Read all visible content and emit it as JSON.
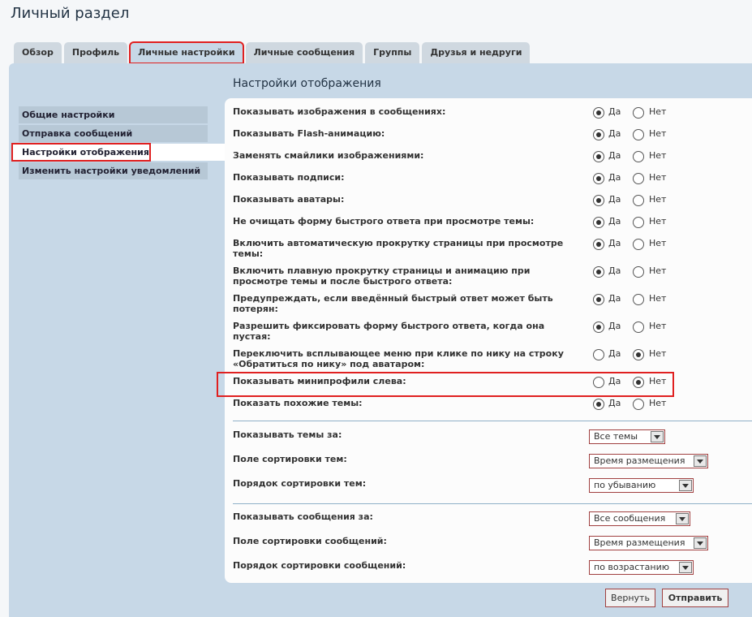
{
  "page": {
    "title": "Личный раздел"
  },
  "tabs": [
    {
      "label": "Обзор"
    },
    {
      "label": "Профиль"
    },
    {
      "label": "Личные настройки"
    },
    {
      "label": "Личные сообщения"
    },
    {
      "label": "Группы"
    },
    {
      "label": "Друзья и недруги"
    }
  ],
  "sidebar": {
    "items": [
      {
        "label": "Общие настройки"
      },
      {
        "label": "Отправка сообщений"
      },
      {
        "label": "Настройки отображения"
      },
      {
        "label": "Изменить настройки уведомлений"
      }
    ]
  },
  "section": {
    "title": "Настройки отображения"
  },
  "yes_label": "Да",
  "no_label": "Нет",
  "options": [
    {
      "label": "Показывать изображения в сообщениях:",
      "value": "Да"
    },
    {
      "label": "Показывать Flash-анимацию:",
      "value": "Да"
    },
    {
      "label": "Заменять смайлики изображениями:",
      "value": "Да"
    },
    {
      "label": "Показывать подписи:",
      "value": "Да"
    },
    {
      "label": "Показывать аватары:",
      "value": "Да"
    },
    {
      "label": "Не очищать форму быстрого ответа при просмотре темы:",
      "value": "Да"
    },
    {
      "label": "Включить автоматическую прокрутку страницы при просмотре темы:",
      "value": "Да"
    },
    {
      "label": "Включить плавную прокрутку страницы и анимацию при просмотре темы и после быстрого ответа:",
      "value": "Да"
    },
    {
      "label": "Предупреждать, если введённый быстрый ответ может быть потерян:",
      "value": "Да"
    },
    {
      "label": "Разрешить фиксировать форму быстрого ответа, когда она пустая:",
      "value": "Да"
    },
    {
      "label": "Переключить всплывающее меню при клике по нику на строку «Обратиться по нику» под аватаром:",
      "value": "Нет"
    },
    {
      "label": "Показывать минипрофили слева:",
      "value": "Нет"
    },
    {
      "label": "Показать похожие темы:",
      "value": "Да"
    }
  ],
  "topic_settings": [
    {
      "label": "Показывать темы за:",
      "value": "Все темы"
    },
    {
      "label": "Поле сортировки тем:",
      "value": "Время размещения"
    },
    {
      "label": "Порядок сортировки тем:",
      "value": "по убыванию"
    }
  ],
  "post_settings": [
    {
      "label": "Показывать сообщения за:",
      "value": "Все сообщения"
    },
    {
      "label": "Поле сортировки сообщений:",
      "value": "Время размещения"
    },
    {
      "label": "Порядок сортировки сообщений:",
      "value": "по возрастанию"
    }
  ],
  "buttons": {
    "reset": "Вернуть",
    "submit": "Отправить"
  },
  "colors": {
    "panel": "#c7d8e7",
    "highlight": "#e02020",
    "sidebar_item": "#b7c8d6"
  }
}
